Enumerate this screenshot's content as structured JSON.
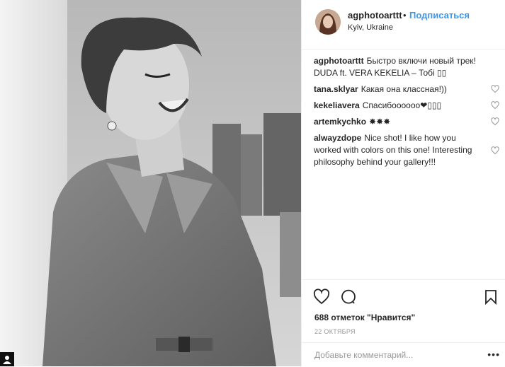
{
  "post": {
    "username": "agphotoarttt",
    "separator": "•",
    "follow_label": "Подписаться",
    "location": "Kyiv, Ukraine"
  },
  "caption": {
    "author": "agphotoarttt",
    "line1": "Быстро включи новый трек!",
    "line2": "DUDA ft. VERA KEKELIA – Тобі ▯▯"
  },
  "comments": [
    {
      "author": "tana.sklyar",
      "text": "Какая она классная!))"
    },
    {
      "author": "kekeliavera",
      "text": "Спасибоооооо❤▯▯▯"
    },
    {
      "author": "artemkychko",
      "text": "✸✸✸"
    },
    {
      "author": "alwayzdope",
      "text": "Nice shot! I like how you worked with colors on this one! Interesting philosophy behind your gallery!!!"
    }
  ],
  "actions": {
    "like_icon": "heart-outline-icon",
    "comment_icon": "comment-bubble-icon",
    "save_icon": "bookmark-icon",
    "likes_text": "688 отметок \"Нравится\"",
    "date": "22 ОКТЯБРЯ"
  },
  "add_comment": {
    "placeholder": "Добавьте комментарий...",
    "more": "•••"
  },
  "colors": {
    "link": "#3897f0",
    "text": "#262626",
    "muted": "#999999",
    "border": "#efefef"
  }
}
